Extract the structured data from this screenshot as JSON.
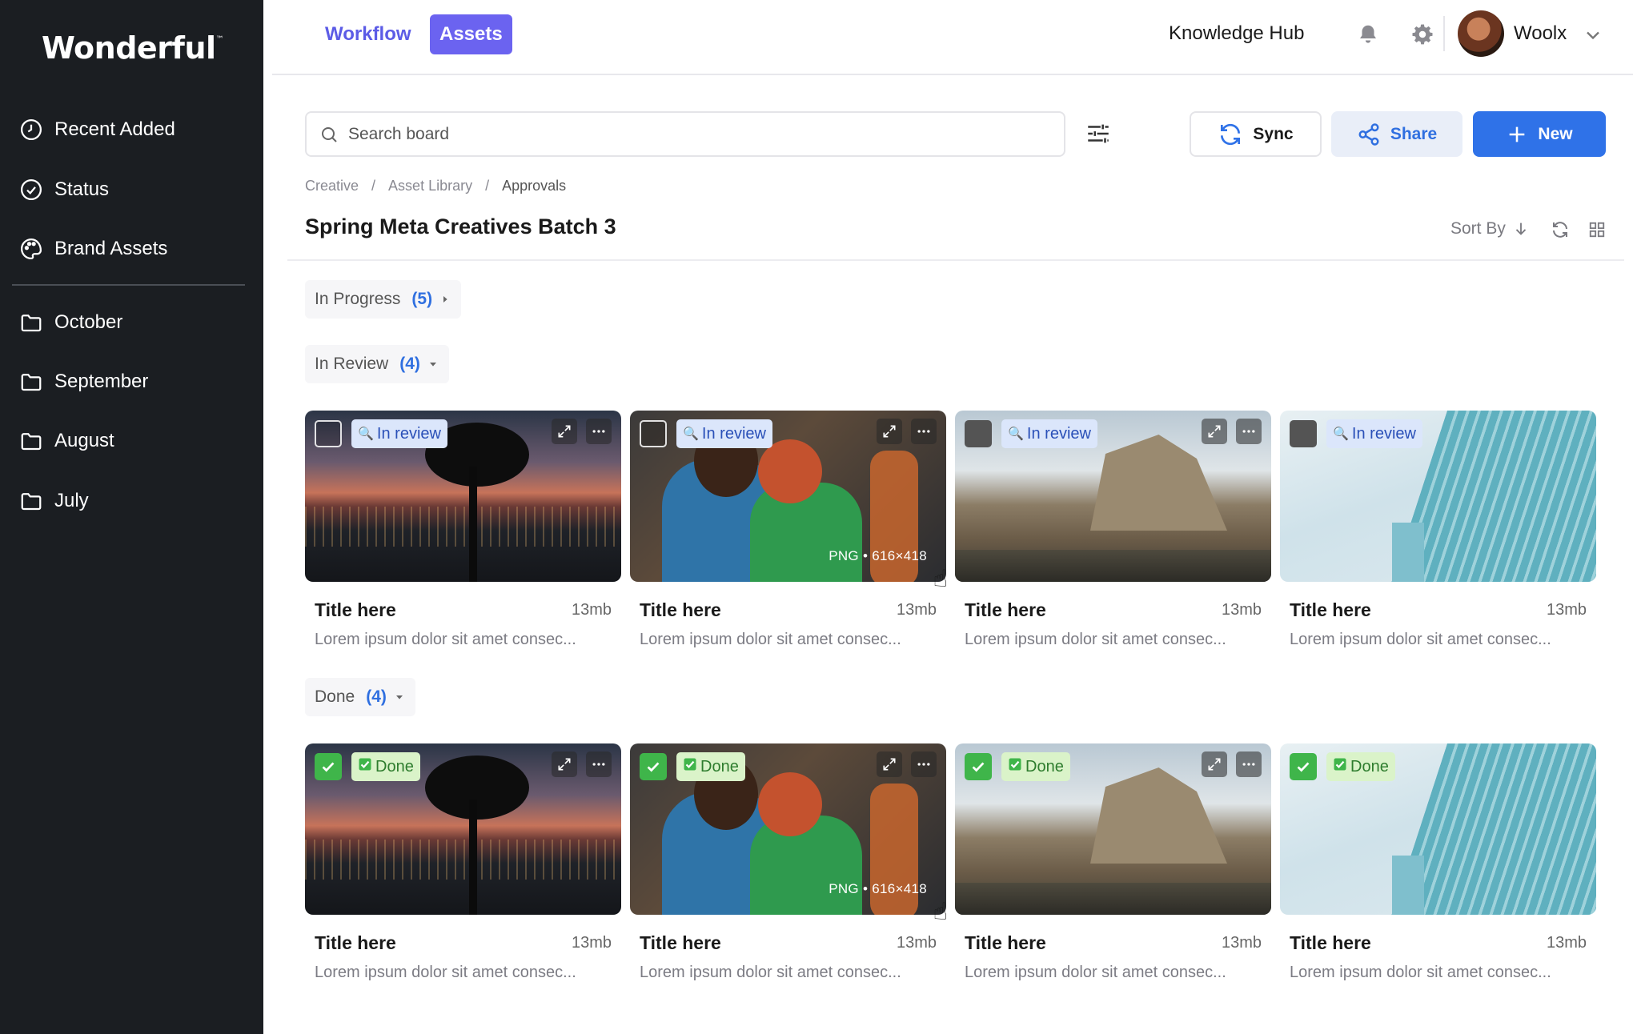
{
  "brand": {
    "name": "Wonderful",
    "mark": "™"
  },
  "sidebar": {
    "items": [
      {
        "label": "Recent Added",
        "icon": "clock-icon"
      },
      {
        "label": "Status",
        "icon": "check-circle-icon"
      },
      {
        "label": "Brand Assets",
        "icon": "palette-icon"
      }
    ],
    "folders": [
      {
        "label": "October",
        "icon": "folder-icon"
      },
      {
        "label": "September",
        "icon": "folder-icon"
      },
      {
        "label": "August",
        "icon": "folder-icon"
      },
      {
        "label": "July",
        "icon": "folder-icon"
      }
    ]
  },
  "header": {
    "tabs": [
      {
        "label": "Workflow",
        "active": false
      },
      {
        "label": "Assets",
        "active": true
      }
    ],
    "hub_label": "Knowledge Hub",
    "user_name": "Woolx"
  },
  "toolbar": {
    "search_placeholder": "Search board",
    "sync_label": "Sync",
    "share_label": "Share",
    "new_label": "New"
  },
  "breadcrumb": [
    "Creative",
    "Asset Library",
    "Approvals"
  ],
  "page": {
    "title": "Spring Meta Creatives Batch 3",
    "sort_label": "Sort By"
  },
  "groups": {
    "in_progress": {
      "label": "In Progress",
      "count": "(5)",
      "expanded": false
    },
    "in_review": {
      "label": "In Review",
      "count": "(4)",
      "expanded": true
    },
    "done": {
      "label": "Done",
      "count": "(4)",
      "expanded": true
    }
  },
  "cards": {
    "review": [
      {
        "status": "In review",
        "title": "Title here",
        "size": "13mb",
        "desc": "Lorem ipsum dolor sit amet consec...",
        "scene": "sunset"
      },
      {
        "status": "In review",
        "title": "Title here",
        "size": "13mb",
        "desc": "Lorem ipsum dolor sit amet consec...",
        "scene": "people",
        "meta": "PNG  •  616×418"
      },
      {
        "status": "In review",
        "title": "Title here",
        "size": "13mb",
        "desc": "Lorem ipsum dolor sit amet consec...",
        "scene": "rocks"
      },
      {
        "status": "In review",
        "title": "Title here",
        "size": "13mb",
        "desc": "Lorem ipsum dolor sit amet consec...",
        "scene": "building"
      }
    ],
    "done": [
      {
        "status": "Done",
        "title": "Title here",
        "size": "13mb",
        "desc": "Lorem ipsum dolor sit amet consec...",
        "scene": "sunset"
      },
      {
        "status": "Done",
        "title": "Title here",
        "size": "13mb",
        "desc": "Lorem ipsum dolor sit amet consec...",
        "scene": "people",
        "meta": "PNG  •  616×418"
      },
      {
        "status": "Done",
        "title": "Title here",
        "size": "13mb",
        "desc": "Lorem ipsum dolor sit amet consec...",
        "scene": "rocks"
      },
      {
        "status": "Done",
        "title": "Title here",
        "size": "13mb",
        "desc": "Lorem ipsum dolor sit amet consec...",
        "scene": "building"
      }
    ]
  },
  "colors": {
    "sidebar_bg": "#1b1e22",
    "accent_purple": "#6b63f0",
    "accent_blue": "#2f72e8",
    "review_badge": "#dbe6fb",
    "done_badge": "#daf3c9",
    "done_check": "#3fb54a"
  }
}
